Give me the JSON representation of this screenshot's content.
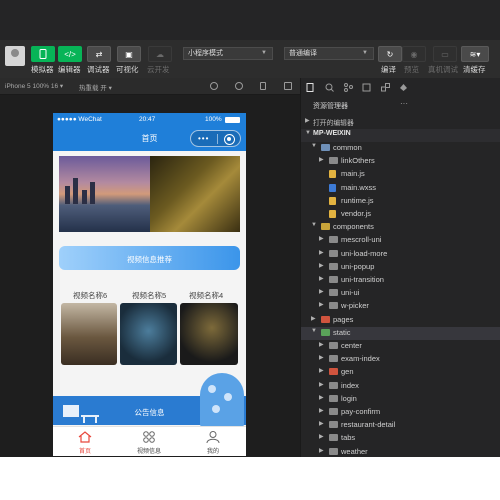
{
  "toolbar": {
    "simulator": "模拟器",
    "editor": "编辑器",
    "debugger": "调试器",
    "visual": "可视化",
    "cloud": "云开发",
    "mode_select": "小程序模式",
    "compile_select": "普通编译",
    "compile": "编译",
    "preview": "预览",
    "remote_debug": "真机调试",
    "clear_cache": "清缓存"
  },
  "subbar": {
    "device": "iPhone 5 100% 16 ▾",
    "hot_reload": "热重载 开 ▾"
  },
  "phone": {
    "carrier": "●●●●● WeChat",
    "time": "20:47",
    "battery": "100%",
    "title": "首页",
    "recommend": "视频信息推荐",
    "videos": [
      "视频名称6",
      "视频名称5",
      "视频名称4"
    ],
    "notice": "公告信息",
    "tabs": [
      "首页",
      "视频信息",
      "我的"
    ]
  },
  "explorer": {
    "title": "资源管理器",
    "more": "···",
    "open_editors": "打开的编辑器",
    "project": "MP-WEIXIN",
    "tree": [
      "common",
      "linkOthers",
      "main.js",
      "main.wxss",
      "runtime.js",
      "vendor.js",
      "components",
      "mescroll-uni",
      "uni-load-more",
      "uni-popup",
      "uni-transition",
      "uni-ui",
      "w-picker",
      "pages",
      "static",
      "center",
      "exam-index",
      "gen",
      "index",
      "login",
      "pay-confirm",
      "restaurant-detail",
      "tabs",
      "weather"
    ]
  },
  "colors": {
    "accent_green": "#07b457",
    "wechat_blue": "#1f7fd9",
    "active_tab": "#e8473c"
  }
}
